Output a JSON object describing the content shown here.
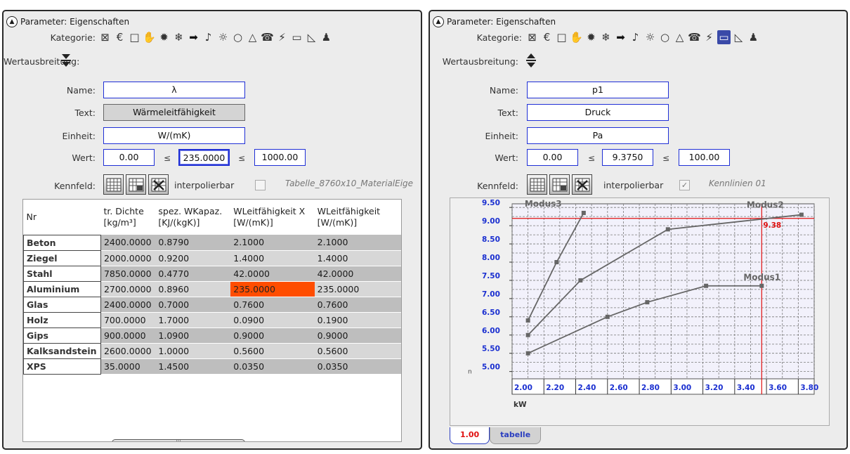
{
  "left": {
    "title": "Parameter: Eigenschaften",
    "labels": {
      "kategorie": "Kategorie:",
      "wertausbreitung": "Wertausbreitung:",
      "name": "Name:",
      "text": "Text:",
      "einheit": "Einheit:",
      "wert": "Wert:",
      "kennfeld": "Kennfeld:"
    },
    "name_value": "λ",
    "text_value": "Wärmeleitfähigkeit",
    "einheit_value": "W/(mK)",
    "wert_min": "0.00",
    "wert_value": "235.0000",
    "wert_max": "1000.00",
    "leq": "≤",
    "interpolierbar_label": "interpolierbar",
    "interpolierbar_checked": false,
    "kennfeld_source": "Tabelle_8760x10_MaterialEige",
    "table": {
      "headers": [
        "Nr",
        "tr. Dichte\n[kg/m³]",
        "spez. WKapaz.\n[KJ/(kgK)]",
        "WLeitfähigkeit X\n[W/(mK)]",
        "WLeitfähigkeit\n[W/(mK)]"
      ],
      "rows": [
        [
          "Beton",
          "2400.0000",
          "0.8790",
          "2.1000",
          "2.1000"
        ],
        [
          "Ziegel",
          "2000.0000",
          "0.9200",
          "1.4000",
          "1.4000"
        ],
        [
          "Stahl",
          "7850.0000",
          "0.4770",
          "42.0000",
          "42.0000"
        ],
        [
          "Aluminium",
          "2700.0000",
          "0.8960",
          "235.0000",
          "235.0000"
        ],
        [
          "Glas",
          "2400.0000",
          "0.7000",
          "0.7600",
          "0.7600"
        ],
        [
          "Holz",
          "700.0000",
          "1.7000",
          "0.0900",
          "0.1900"
        ],
        [
          "Gips",
          "900.0000",
          "1.0900",
          "0.9000",
          "0.9000"
        ],
        [
          "Kalksandstein",
          "2600.0000",
          "1.0000",
          "0.5600",
          "0.5600"
        ],
        [
          "XPS",
          "35.0000",
          "1.4500",
          "0.0350",
          "0.0350"
        ]
      ],
      "highlight_cell": {
        "row": 3,
        "col": 3,
        "color": "#ff4d00"
      }
    },
    "scrollbar_grip": "|||"
  },
  "right": {
    "title": "Parameter: Eigenschaften",
    "labels": {
      "kategorie": "Kategorie:",
      "wertausbreitung": "Wertausbreitung:",
      "name": "Name:",
      "text": "Text:",
      "einheit": "Einheit:",
      "wert": "Wert:",
      "kennfeld": "Kennfeld:"
    },
    "name_value": "p1",
    "text_value": "Druck",
    "einheit_value": "Pa",
    "wert_min": "0.00",
    "wert_value": "9.3750",
    "wert_max": "100.00",
    "leq": "≤",
    "interpolierbar_label": "interpolierbar",
    "interpolierbar_checked": true,
    "kennfeld_source": "Kennlinien 01",
    "tabs": [
      {
        "label": "1.00",
        "active": true
      },
      {
        "label": "tabelle",
        "active": false
      }
    ]
  },
  "category_icons": [
    "box-cross-icon",
    "euro-icon",
    "square-icon",
    "hand-icon",
    "gear-burst-icon",
    "snowflake-icon",
    "arrow-right-icon",
    "speaker-icon",
    "sun-icon",
    "bulb-icon",
    "drop-icon",
    "phone-icon",
    "lightning-icon",
    "bucket-icon",
    "ruler-triangle-icon",
    "person-icon"
  ],
  "colors": {
    "accent_blue": "#1f2fd6",
    "highlight": "#ff4d00",
    "chart_red": "#e01010",
    "chart_tick_blue": "#1a2fd0"
  },
  "chart_data": {
    "type": "line",
    "xlabel": "kW",
    "ylabel": "",
    "xlim": [
      2.0,
      3.9
    ],
    "ylim": [
      4.8,
      9.6
    ],
    "x_ticks": [
      "2.00",
      "2.20",
      "2.40",
      "2.60",
      "2.80",
      "3.00",
      "3.20",
      "3.40",
      "3.60",
      "3.80"
    ],
    "y_ticks": [
      "5.00",
      "5.50",
      "6.00",
      "6.50",
      "7.00",
      "7.50",
      "8.00",
      "8.50",
      "9.00",
      "9.50"
    ],
    "series": [
      {
        "name": "Modus1",
        "x": [
          2.1,
          2.6,
          2.85,
          3.22,
          3.57
        ],
        "y": [
          5.5,
          6.5,
          6.9,
          7.35,
          7.35
        ]
      },
      {
        "name": "Modus2",
        "x": [
          2.1,
          2.43,
          2.98,
          3.82
        ],
        "y": [
          6.0,
          7.5,
          8.9,
          9.3
        ]
      },
      {
        "name": "Modus3",
        "x": [
          2.1,
          2.28,
          2.45
        ],
        "y": [
          6.4,
          8.0,
          9.35
        ]
      }
    ],
    "crosshair": {
      "x": 3.57,
      "y": 9.2,
      "value_label": "9.38"
    }
  }
}
